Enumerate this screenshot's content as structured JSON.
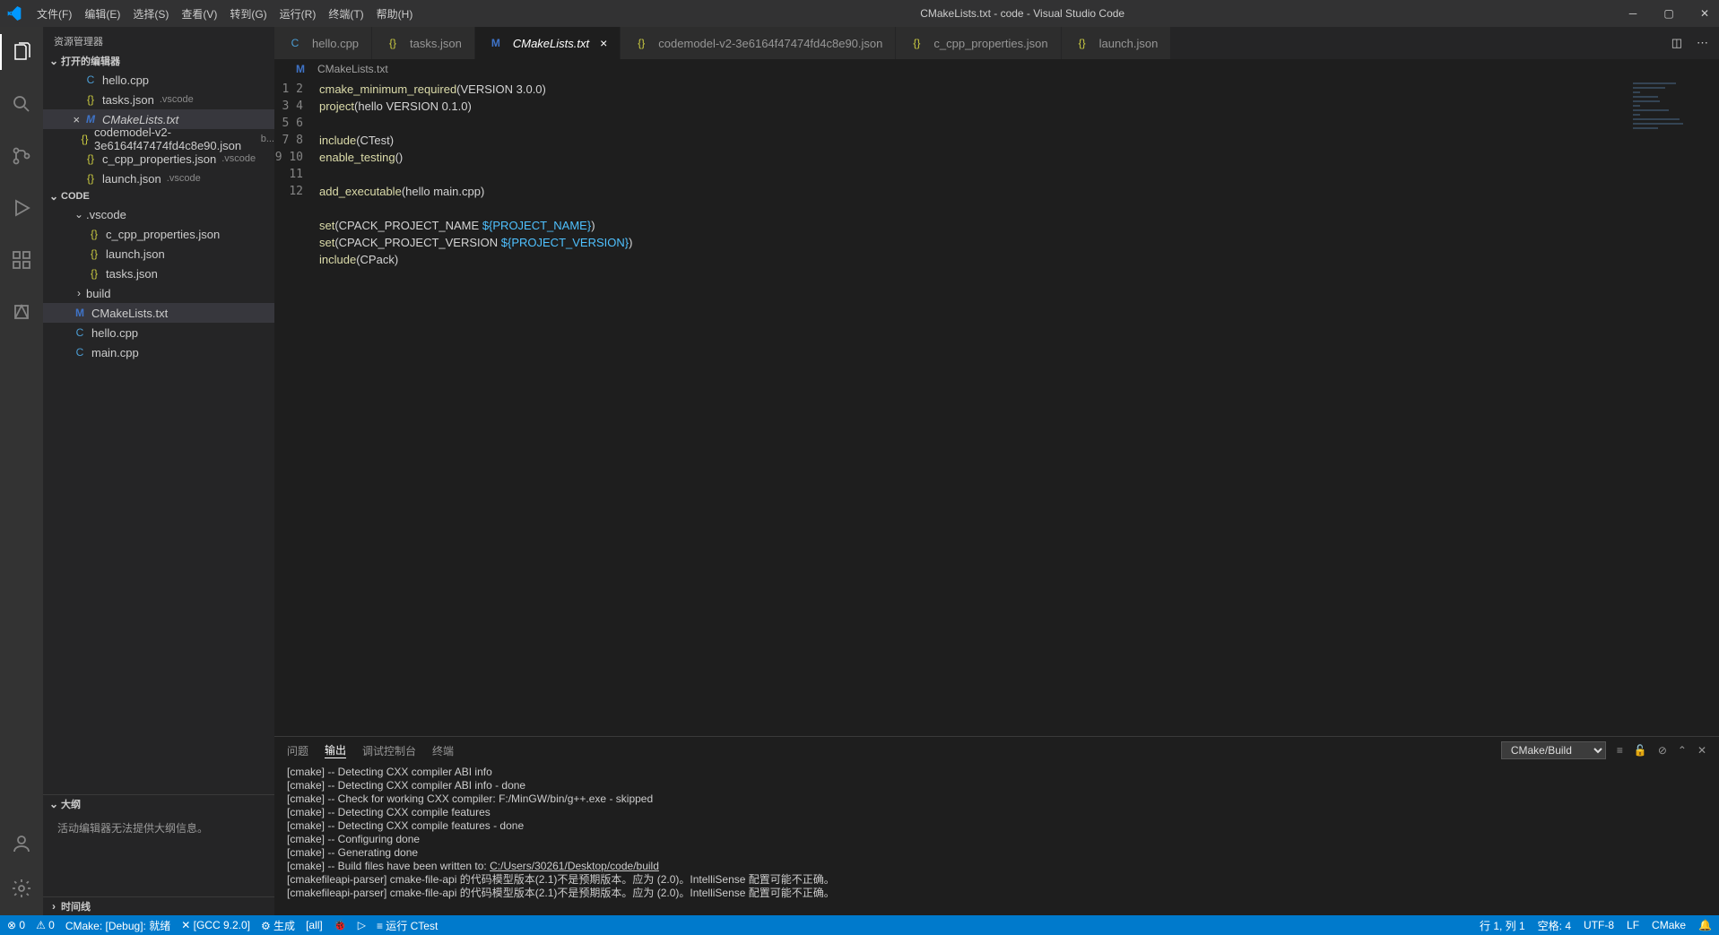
{
  "window": {
    "title": "CMakeLists.txt - code - Visual Studio Code"
  },
  "menu": [
    "文件(F)",
    "编辑(E)",
    "选择(S)",
    "查看(V)",
    "转到(G)",
    "运行(R)",
    "终端(T)",
    "帮助(H)"
  ],
  "sidebar": {
    "title": "资源管理器",
    "openEditors": {
      "label": "打开的编辑器"
    },
    "open": [
      {
        "icon": "cpp",
        "glyph": "C",
        "name": "hello.cpp"
      },
      {
        "icon": "json",
        "glyph": "{}",
        "name": "tasks.json",
        "dim": ".vscode"
      },
      {
        "icon": "cmake",
        "glyph": "M",
        "name": "CMakeLists.txt",
        "selected": true,
        "closeable": true
      },
      {
        "icon": "json",
        "glyph": "{}",
        "name": "codemodel-v2-3e6164f47474fd4c8e90.json",
        "dim": "b..."
      },
      {
        "icon": "json",
        "glyph": "{}",
        "name": "c_cpp_properties.json",
        "dim": ".vscode"
      },
      {
        "icon": "json",
        "glyph": "{}",
        "name": "launch.json",
        "dim": ".vscode"
      }
    ],
    "workspace": {
      "label": "CODE"
    },
    "tree": [
      {
        "type": "folder",
        "name": ".vscode",
        "open": true,
        "indent": 2
      },
      {
        "type": "file",
        "icon": "json",
        "glyph": "{}",
        "name": "c_cpp_properties.json",
        "indent": 3
      },
      {
        "type": "file",
        "icon": "json",
        "glyph": "{}",
        "name": "launch.json",
        "indent": 3
      },
      {
        "type": "file",
        "icon": "json",
        "glyph": "{}",
        "name": "tasks.json",
        "indent": 3
      },
      {
        "type": "folder",
        "name": "build",
        "open": false,
        "indent": 2
      },
      {
        "type": "file",
        "icon": "cmake",
        "glyph": "M",
        "name": "CMakeLists.txt",
        "indent": 2,
        "selected": true
      },
      {
        "type": "file",
        "icon": "cpp",
        "glyph": "C",
        "name": "hello.cpp",
        "indent": 2
      },
      {
        "type": "file",
        "icon": "cpp",
        "glyph": "C",
        "name": "main.cpp",
        "indent": 2
      }
    ],
    "outline": {
      "label": "大纲",
      "msg": "活动编辑器无法提供大纲信息。"
    },
    "timeline": {
      "label": "时间线"
    }
  },
  "tabs": [
    {
      "icon": "cpp",
      "glyph": "C",
      "name": "hello.cpp"
    },
    {
      "icon": "json",
      "glyph": "{}",
      "name": "tasks.json"
    },
    {
      "icon": "cmake",
      "glyph": "M",
      "name": "CMakeLists.txt",
      "active": true,
      "italic": true
    },
    {
      "icon": "json",
      "glyph": "{}",
      "name": "codemodel-v2-3e6164f47474fd4c8e90.json"
    },
    {
      "icon": "json",
      "glyph": "{}",
      "name": "c_cpp_properties.json"
    },
    {
      "icon": "json",
      "glyph": "{}",
      "name": "launch.json"
    }
  ],
  "breadcrumb": {
    "icon": "M",
    "name": "CMakeLists.txt"
  },
  "code": {
    "lines": [
      [
        {
          "c": "fn",
          "t": "cmake_minimum_required"
        },
        {
          "c": "plain",
          "t": "(VERSION 3.0.0)"
        }
      ],
      [
        {
          "c": "fn",
          "t": "project"
        },
        {
          "c": "plain",
          "t": "(hello VERSION 0.1.0)"
        }
      ],
      [],
      [
        {
          "c": "fn",
          "t": "include"
        },
        {
          "c": "plain",
          "t": "(CTest)"
        }
      ],
      [
        {
          "c": "fn",
          "t": "enable_testing"
        },
        {
          "c": "plain",
          "t": "()"
        }
      ],
      [],
      [
        {
          "c": "fn",
          "t": "add_executable"
        },
        {
          "c": "plain",
          "t": "(hello main.cpp)"
        }
      ],
      [],
      [
        {
          "c": "fn",
          "t": "set"
        },
        {
          "c": "plain",
          "t": "(CPACK_PROJECT_NAME "
        },
        {
          "c": "var",
          "t": "${PROJECT_NAME}"
        },
        {
          "c": "plain",
          "t": ")"
        }
      ],
      [
        {
          "c": "fn",
          "t": "set"
        },
        {
          "c": "plain",
          "t": "(CPACK_PROJECT_VERSION "
        },
        {
          "c": "var",
          "t": "${PROJECT_VERSION}"
        },
        {
          "c": "plain",
          "t": ")"
        }
      ],
      [
        {
          "c": "fn",
          "t": "include"
        },
        {
          "c": "plain",
          "t": "(CPack)"
        }
      ],
      []
    ]
  },
  "panel": {
    "tabs": [
      "问题",
      "输出",
      "调试控制台",
      "终端"
    ],
    "active": 1,
    "select": "CMake/Build",
    "lines": [
      "[cmake] -- Detecting CXX compiler ABI info",
      "[cmake] -- Detecting CXX compiler ABI info - done",
      "[cmake] -- Check for working CXX compiler: F:/MinGW/bin/g++.exe - skipped",
      "[cmake] -- Detecting CXX compile features",
      "[cmake] -- Detecting CXX compile features - done",
      "[cmake] -- Configuring done",
      "[cmake] -- Generating done",
      {
        "prefix": "[cmake] -- Build files have been written to: ",
        "link": "C:/Users/30261/Desktop/code/build"
      },
      "[cmakefileapi-parser] cmake-file-api 的代码模型版本(2.1)不是预期版本。应为 (2.0)。IntelliSense 配置可能不正确。",
      "[cmakefileapi-parser] cmake-file-api 的代码模型版本(2.1)不是预期版本。应为 (2.0)。IntelliSense 配置可能不正确。"
    ]
  },
  "status": {
    "left": [
      {
        "icon": "⊗",
        "t": "0"
      },
      {
        "icon": "⚠",
        "t": "0"
      },
      {
        "t": "CMake: [Debug]: 就绪"
      },
      {
        "icon": "✕",
        "t": "[GCC 9.2.0]"
      },
      {
        "icon": "⚙",
        "t": "生成"
      },
      {
        "t": "[all]"
      },
      {
        "icon": "🐞",
        "t": ""
      },
      {
        "icon": "▷",
        "t": ""
      },
      {
        "icon": "≡",
        "t": "运行 CTest"
      }
    ],
    "right": [
      "行 1, 列 1",
      "空格: 4",
      "UTF-8",
      "LF",
      "CMake",
      "🔔"
    ]
  }
}
